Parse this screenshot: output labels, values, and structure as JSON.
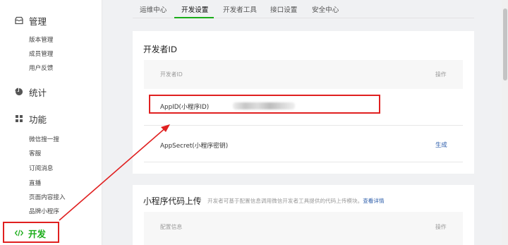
{
  "sidebar": {
    "manage": {
      "label": "管理",
      "icon": "box-icon",
      "items": [
        "版本管理",
        "成员管理",
        "用户反馈"
      ]
    },
    "stats": {
      "label": "统计",
      "icon": "pie-chart-icon"
    },
    "features": {
      "label": "功能",
      "icon": "grid-icon",
      "items": [
        "微信搜一搜",
        "客服",
        "订阅消息",
        "直播",
        "页面内容接入",
        "品牌小程序"
      ]
    },
    "develop": {
      "label": "开发",
      "icon": "code-icon",
      "active": true
    }
  },
  "tabs": [
    "运维中心",
    "开发设置",
    "开发者工具",
    "接口设置",
    "安全中心"
  ],
  "active_tab": "开发设置",
  "developer_id": {
    "title": "开发者ID",
    "col_id": "开发者ID",
    "col_action": "操作",
    "rows": [
      {
        "label": "AppID(小程序ID)",
        "value_hidden": true
      },
      {
        "label": "AppSecret(小程序密钥)",
        "action": "生成"
      }
    ]
  },
  "code_upload": {
    "title": "小程序代码上传",
    "desc": "开发者可基于配置信息调用微信开发者工具提供的代码上传模块。",
    "link": "查看详情",
    "col_config": "配置信息",
    "col_action": "操作"
  },
  "colors": {
    "accent_green": "#1aad19",
    "annotation_red": "#e02020",
    "link_blue": "#2b5caa"
  }
}
